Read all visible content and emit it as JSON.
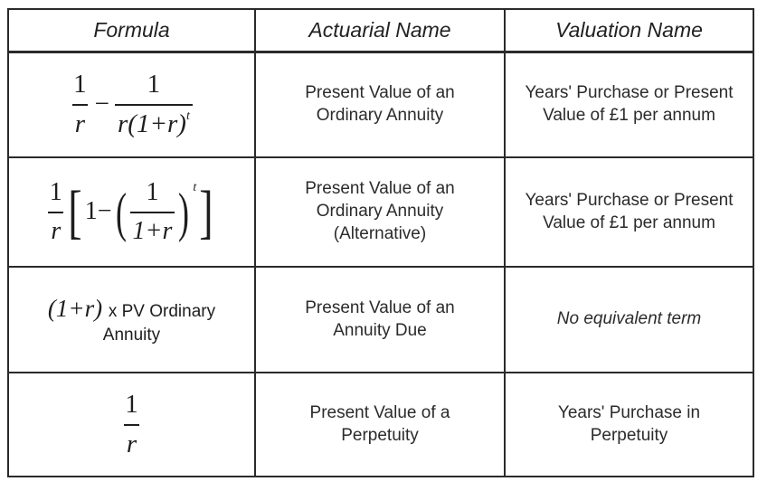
{
  "headers": {
    "formula": "Formula",
    "actuarial": "Actuarial Name",
    "valuation": "Valuation Name"
  },
  "rows": [
    {
      "formula": {
        "one": "1",
        "r": "r",
        "minus": "−",
        "den": "r(1+r)",
        "t": "t"
      },
      "actuarial": "Present Value of an Ordinary Annuity",
      "valuation": "Years' Purchase or Present Value of £1 per annum"
    },
    {
      "formula": {
        "one": "1",
        "r": "r",
        "inner": "1−",
        "frac_num": "1",
        "frac_den": "1+r",
        "t": "t"
      },
      "actuarial": "Present Value of an Ordinary Annuity (Alternative)",
      "valuation": "Years' Purchase or Present Value of £1 per annum"
    },
    {
      "formula": {
        "math": "(1+r)",
        "text1": "x PV Ordinary",
        "text2": "Annuity"
      },
      "actuarial": "Present Value of an Annuity Due",
      "valuation": "No equivalent term"
    },
    {
      "formula": {
        "num": "1",
        "den": "r"
      },
      "actuarial": "Present Value of a Perpetuity",
      "valuation": "Years' Purchase in Perpetuity"
    }
  ]
}
